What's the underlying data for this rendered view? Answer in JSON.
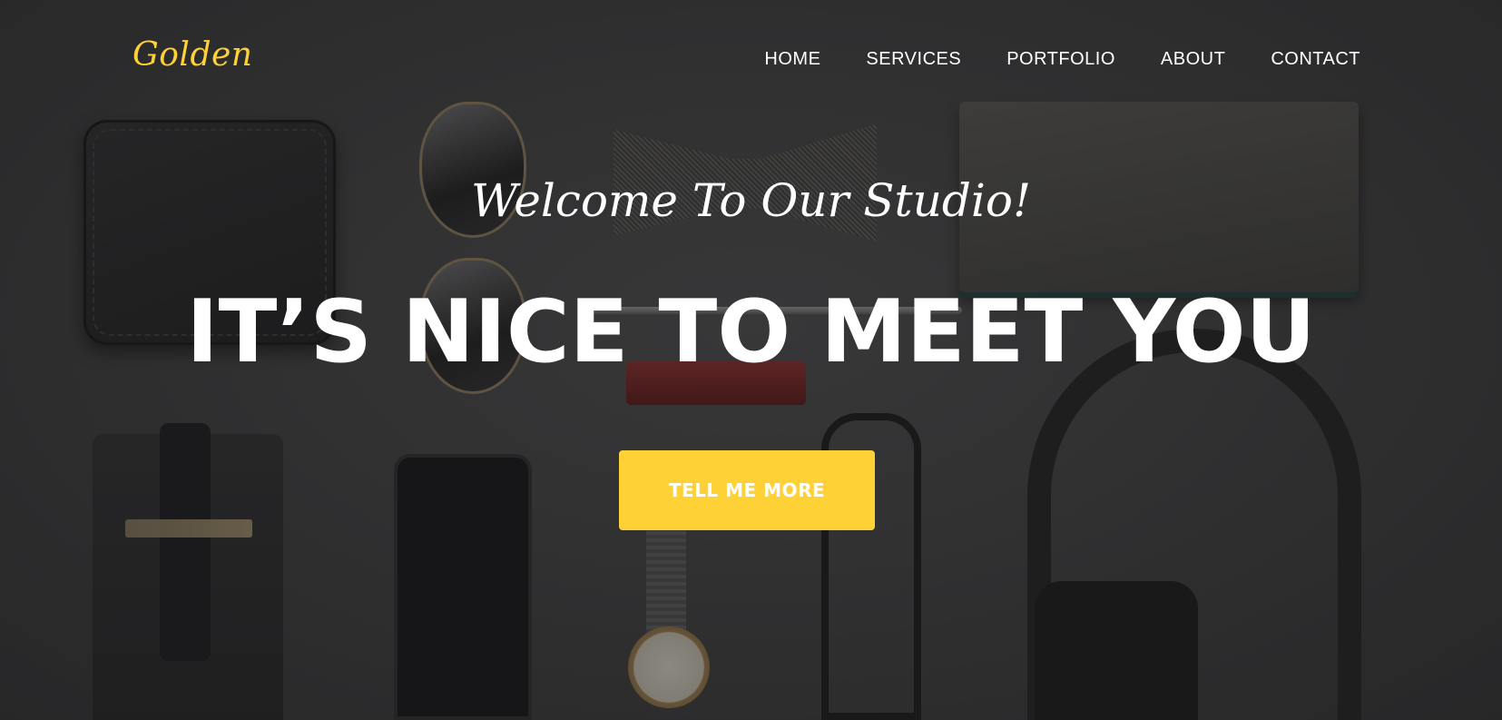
{
  "brand": {
    "name": "Golden",
    "color": "#fed136"
  },
  "nav": {
    "items": [
      {
        "label": "HOME"
      },
      {
        "label": "SERVICES"
      },
      {
        "label": "PORTFOLIO"
      },
      {
        "label": "ABOUT"
      },
      {
        "label": "CONTACT"
      }
    ]
  },
  "hero": {
    "lead_in": "Welcome To Our Studio!",
    "heading": "IT’S NICE TO MEET YOU",
    "cta_label": "TELL ME MORE",
    "accent_color": "#fed136",
    "background": "flat-lay photo of wallet, sunglasses, bow tie, notebook, phone, watch, glasses and headphones on dark surface"
  }
}
